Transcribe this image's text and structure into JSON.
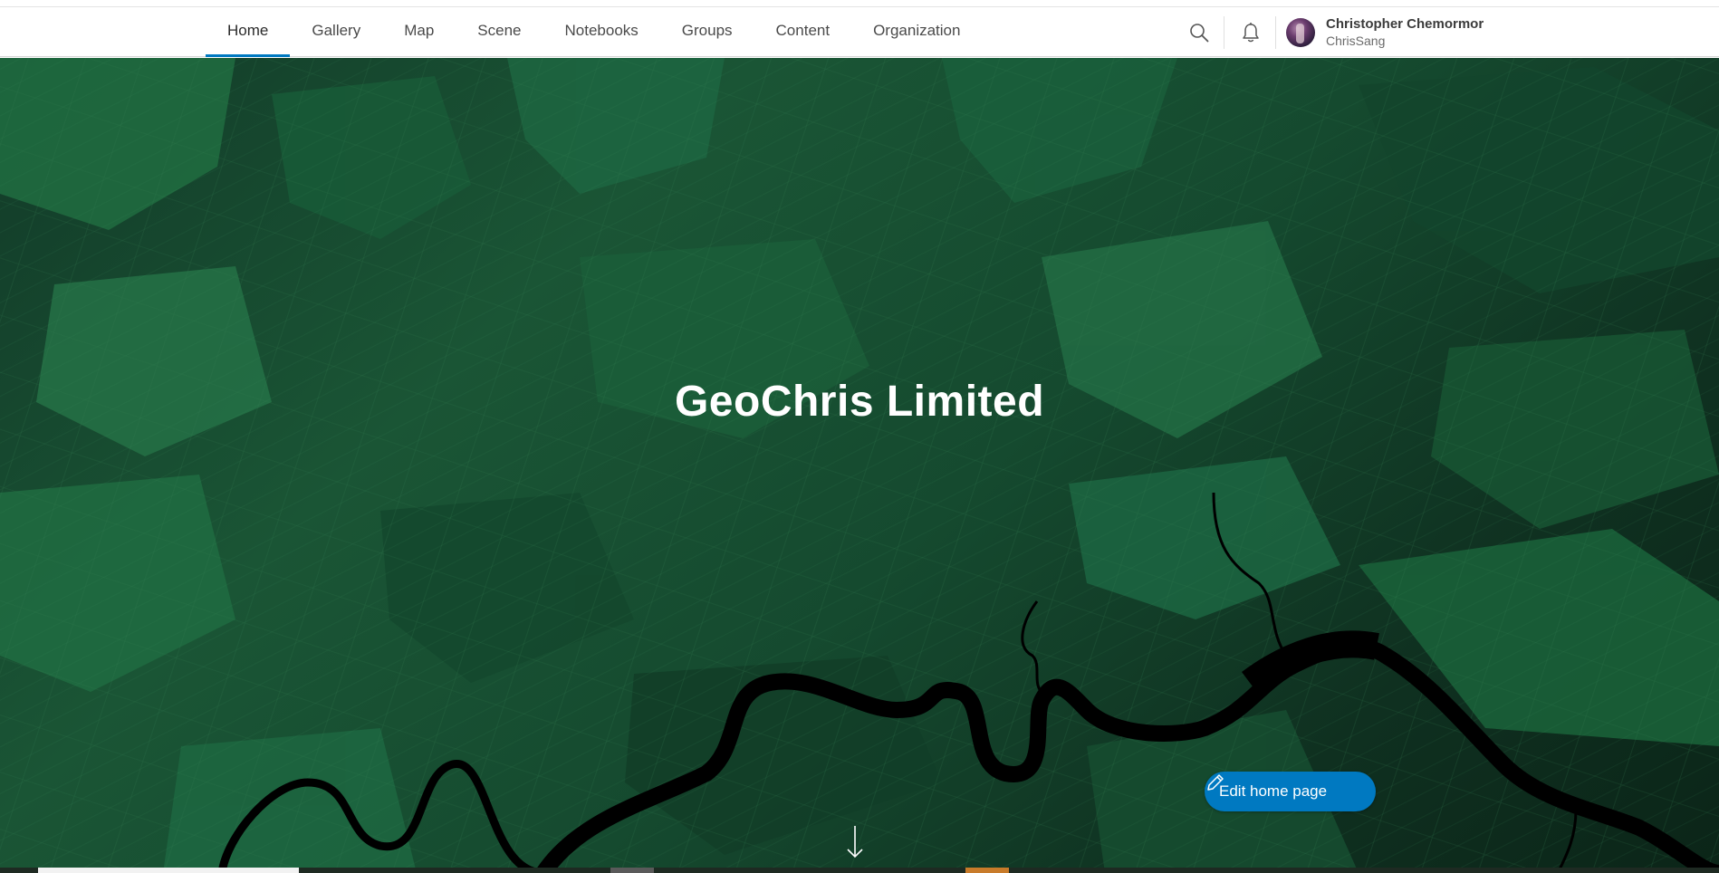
{
  "nav": {
    "tabs": [
      {
        "label": "Home",
        "active": true
      },
      {
        "label": "Gallery",
        "active": false
      },
      {
        "label": "Map",
        "active": false
      },
      {
        "label": "Scene",
        "active": false
      },
      {
        "label": "Notebooks",
        "active": false
      },
      {
        "label": "Groups",
        "active": false
      },
      {
        "label": "Content",
        "active": false
      },
      {
        "label": "Organization",
        "active": false
      }
    ],
    "search_icon": "search-icon",
    "notifications_icon": "bell-icon"
  },
  "user": {
    "full_name": "Christopher Chemormor",
    "username": "ChrisSang"
  },
  "hero": {
    "title": "GeoChris Limited",
    "edit_button_label": "Edit home page",
    "scroll_icon": "arrow-down-icon"
  },
  "colors": {
    "accent": "#0079c1",
    "hero_green": "#1a5535",
    "river": "#000000"
  }
}
